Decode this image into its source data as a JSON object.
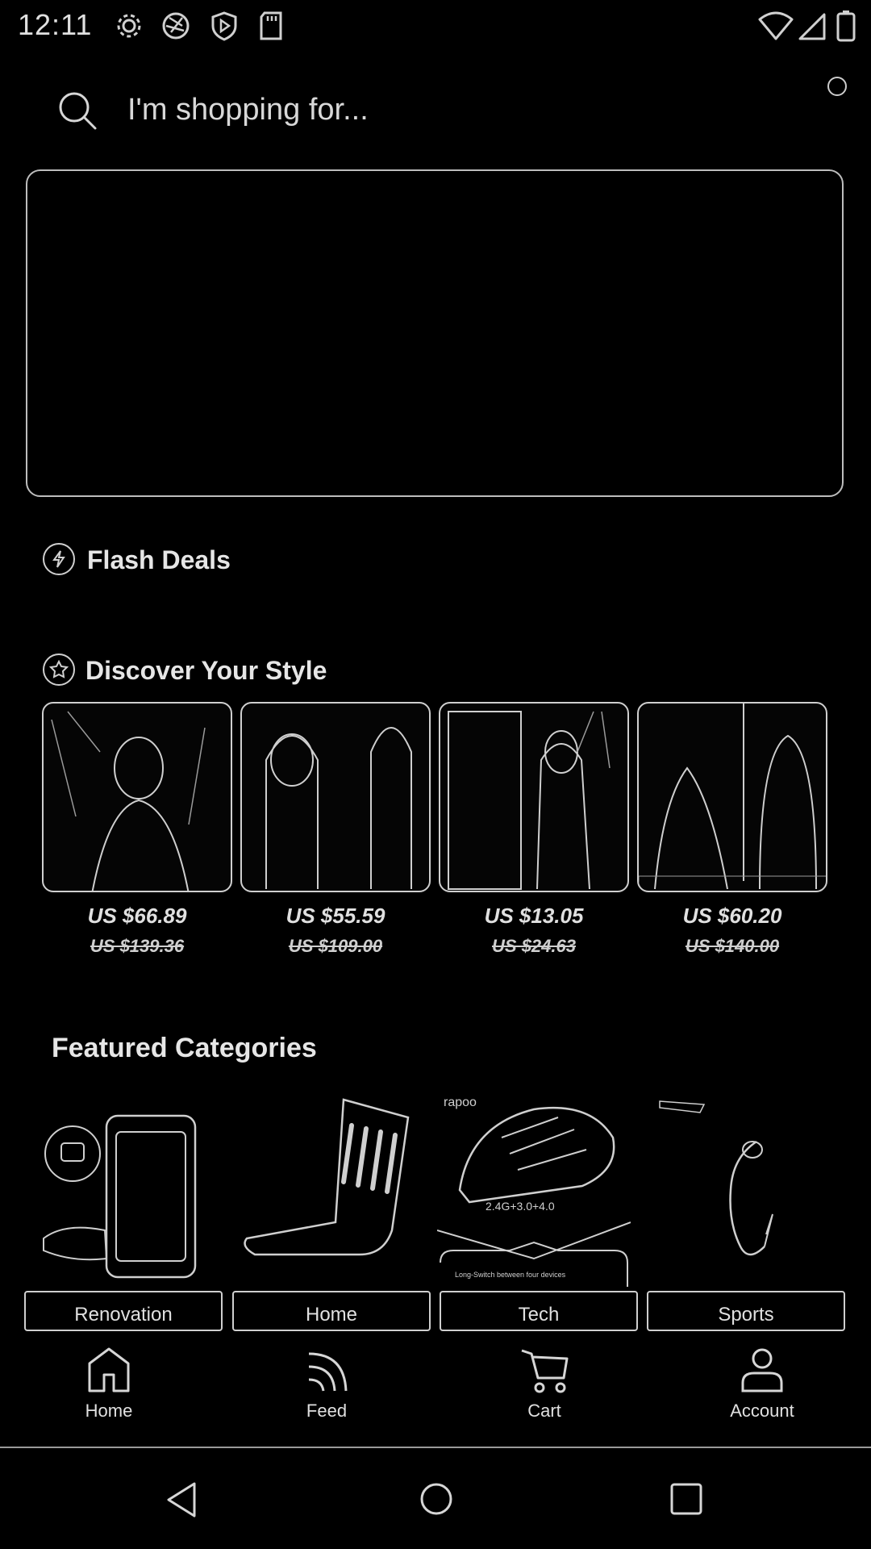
{
  "status_bar": {
    "time": "12:11",
    "icons": [
      "settings-icon",
      "aperture-icon",
      "shield-play-icon",
      "sd-card-icon",
      "wifi-icon",
      "signal-icon",
      "battery-icon"
    ]
  },
  "search": {
    "placeholder": "I'm shopping for..."
  },
  "flash_deals": {
    "title": "Flash Deals"
  },
  "discover": {
    "title": "Discover Your Style",
    "products": [
      {
        "price": "US $66.89",
        "old_price": "US $139.36"
      },
      {
        "price": "US $55.59",
        "old_price": "US $109.00"
      },
      {
        "price": "US $13.05",
        "old_price": "US $24.63"
      },
      {
        "price": "US $60.20",
        "old_price": "US $140.00"
      }
    ]
  },
  "featured": {
    "title": "Featured Categories",
    "categories": [
      {
        "label": "Renovation"
      },
      {
        "label": "Home"
      },
      {
        "label": "Tech",
        "image_text": {
          "brand": "rapoo",
          "spec": "2.4G+3.0+4.0",
          "caption": "Long-Switch between four devices"
        }
      },
      {
        "label": "Sports"
      }
    ]
  },
  "bottom_nav": {
    "items": [
      {
        "label": "Home",
        "icon": "home-icon"
      },
      {
        "label": "Feed",
        "icon": "feed-icon"
      },
      {
        "label": "Cart",
        "icon": "cart-icon"
      },
      {
        "label": "Account",
        "icon": "account-icon"
      }
    ]
  },
  "system_nav": {
    "icons": [
      "back-icon",
      "home-circle-icon",
      "recents-icon"
    ]
  },
  "colors": {
    "background": "#000000",
    "outline": "#cfcfcf",
    "text": "#e0e0e0"
  }
}
